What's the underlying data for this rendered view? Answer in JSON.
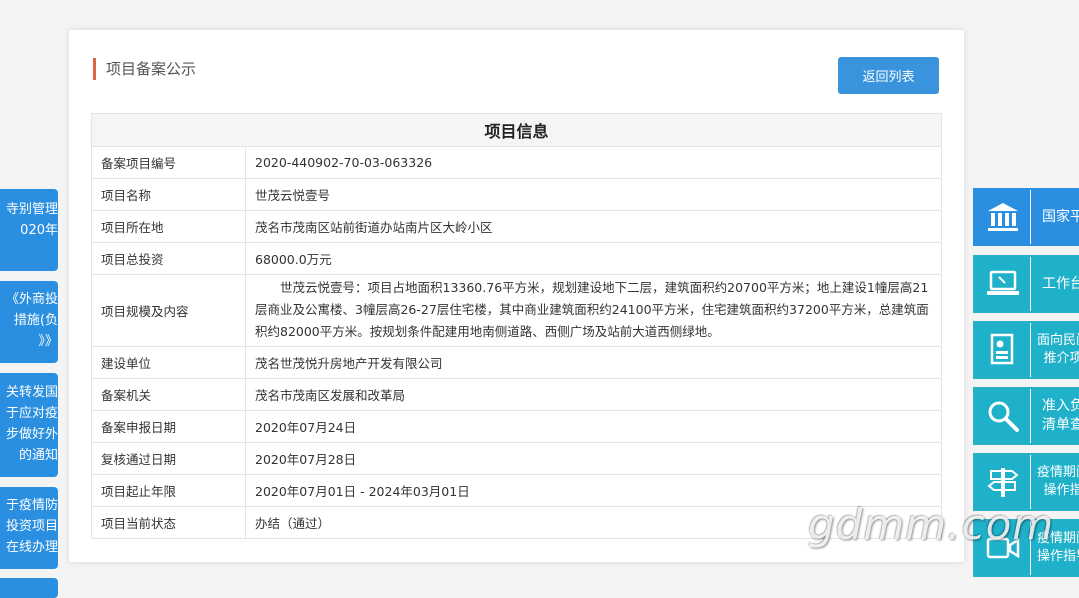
{
  "header": {
    "title": "项目备案公示",
    "back_label": "返回列表"
  },
  "table": {
    "heading": "项目信息",
    "rows": [
      {
        "label": "备案项目编号",
        "value": "2020-440902-70-03-063326"
      },
      {
        "label": "项目名称",
        "value": "世茂云悦壹号"
      },
      {
        "label": "项目所在地",
        "value": "茂名市茂南区站前街道办站南片区大岭小区"
      },
      {
        "label": "项目总投资",
        "value": "68000.0万元"
      },
      {
        "label": "项目规模及内容",
        "value": "世茂云悦壹号：项目占地面积13360.76平方米，规划建设地下二层，建筑面积约20700平方米；地上建设1幢层高21层商业及公寓楼、3幢层高26-27层住宅楼，其中商业建筑面积约24100平方米，住宅建筑面积约37200平方米，总建筑面积约82000平方米。按规划条件配建用地南侧道路、西侧广场及站前大道西侧绿地。"
      },
      {
        "label": "建设单位",
        "value": "茂名世茂悦升房地产开发有限公司"
      },
      {
        "label": "备案机关",
        "value": "茂名市茂南区发展和改革局"
      },
      {
        "label": "备案申报日期",
        "value": "2020年07月24日"
      },
      {
        "label": "复核通过日期",
        "value": "2020年07月28日"
      },
      {
        "label": "项目起止年限",
        "value": "2020年07月01日 - 2024年03月01日"
      },
      {
        "label": "项目当前状态",
        "value": "办结（通过）"
      }
    ]
  },
  "left_notices": [
    {
      "lines": [
        "寺别管理",
        "020年"
      ]
    },
    {
      "lines": [
        "《外商投",
        "措施(负",
        "》》"
      ]
    },
    {
      "lines": [
        "关转发国",
        "于应对疫",
        "步做好外",
        "的通知"
      ]
    },
    {
      "lines": [
        "于疫情防",
        "投资项目",
        "在线办理"
      ]
    }
  ],
  "right_tiles": [
    {
      "icon": "bank-icon",
      "lines": [
        "国家平"
      ],
      "style": "blue"
    },
    {
      "icon": "laptop-icon",
      "lines": [
        "工作台"
      ],
      "style": "teal"
    },
    {
      "icon": "document-icon",
      "lines": [
        "面向民间",
        "推介项"
      ],
      "style": "teal"
    },
    {
      "icon": "search-icon",
      "lines": [
        "准入负",
        "清单查"
      ],
      "style": "teal"
    },
    {
      "icon": "signpost-icon",
      "lines": [
        "疫情期间",
        "操作指"
      ],
      "style": "teal"
    },
    {
      "icon": "video-icon",
      "lines": [
        "疫情期间",
        "操作指导"
      ],
      "style": "teal"
    }
  ],
  "watermark": "gdmm.com",
  "colors": {
    "accent": "#e2634b",
    "button": "#3a93dd",
    "tile_blue": "#2a8fe0",
    "tile_teal": "#1fb1c9"
  }
}
